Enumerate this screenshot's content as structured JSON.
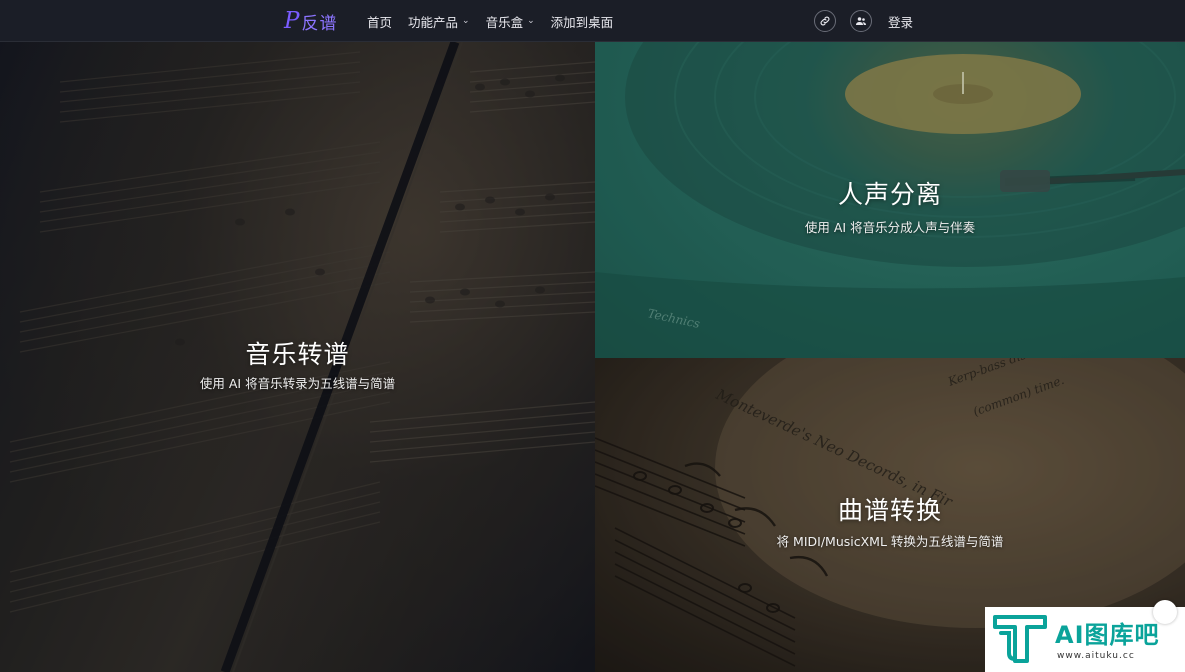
{
  "brand": {
    "name": "反谱",
    "mark": "P"
  },
  "nav": {
    "items": [
      {
        "label": "首页",
        "dropdown": false
      },
      {
        "label": "功能产品",
        "dropdown": true
      },
      {
        "label": "音乐盒",
        "dropdown": true
      },
      {
        "label": "添加到桌面",
        "dropdown": false
      }
    ],
    "login": "登录"
  },
  "panels": {
    "transcription": {
      "title": "音乐转谱",
      "subtitle": "使用 AI 将音乐转录为五线谱与简谱"
    },
    "separation": {
      "title": "人声分离",
      "subtitle": "使用 AI 将音乐分成人声与伴奏"
    },
    "conversion": {
      "title": "曲谱转换",
      "subtitle": "将 MIDI/MusicXML 转换为五线谱与简谱"
    }
  },
  "watermark": {
    "text": "AI图库吧",
    "url": "www.aituku.cc"
  },
  "colors": {
    "brand": "#8c74ff",
    "teal": "#2a7366",
    "watermark": "#0aa39a"
  }
}
